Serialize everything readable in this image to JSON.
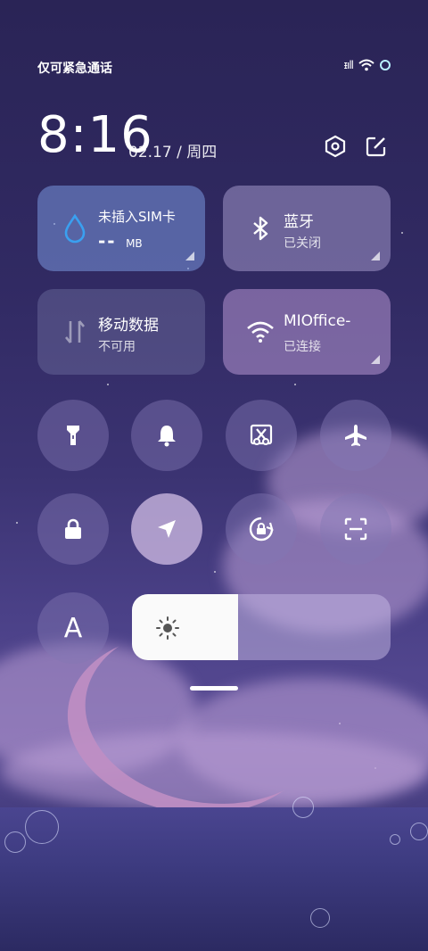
{
  "status_bar": {
    "carrier": "仅可紧急通话",
    "signal_glyph": "ᵻıll",
    "wifi_icon": "wifi-icon",
    "indicator_ring_color": "#b9f1ff"
  },
  "header": {
    "time": "8:16",
    "date": "02.17",
    "separator": "/",
    "weekday": "周四"
  },
  "tiles": {
    "sim": {
      "title": "未插入SIM卡",
      "value": "--",
      "unit": "MB"
    },
    "bluetooth": {
      "title": "蓝牙",
      "status": "已关闭"
    },
    "mobile_data": {
      "title": "移动数据",
      "status": "不可用"
    },
    "wifi": {
      "title": "MIOffice-",
      "status": "已连接"
    }
  },
  "toggles": [
    {
      "icon": "flashlight-icon",
      "active": false
    },
    {
      "icon": "bell-icon",
      "active": false
    },
    {
      "icon": "screenshot-icon",
      "active": false
    },
    {
      "icon": "airplane-icon",
      "active": false
    },
    {
      "icon": "lock-icon",
      "active": false
    },
    {
      "icon": "location-icon",
      "active": true
    },
    {
      "icon": "rotation-lock-icon",
      "active": false
    },
    {
      "icon": "scan-icon",
      "active": false
    },
    {
      "icon": "auto-brightness-icon",
      "label": "A",
      "active": false
    }
  ],
  "brightness": {
    "level": 0.41
  },
  "colors": {
    "accent_droplet": "#3aa0f0",
    "active_toggle": "#d2bee6"
  }
}
